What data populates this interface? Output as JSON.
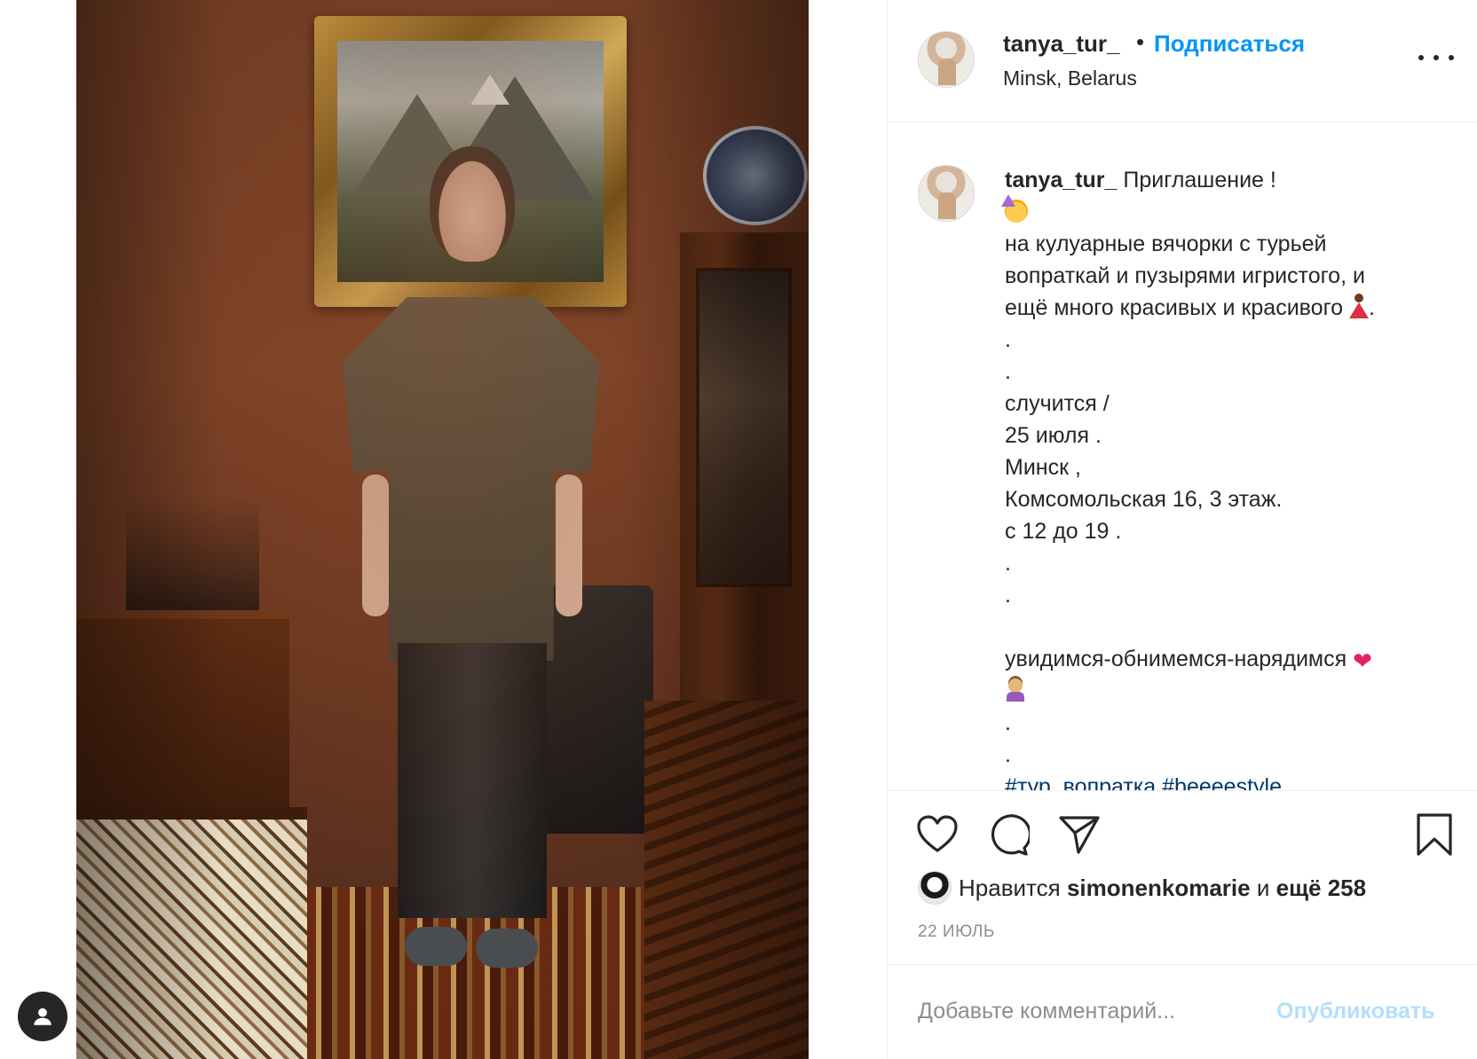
{
  "header": {
    "username": "tanya_tur_",
    "separator": "•",
    "follow_label": "Подписаться",
    "location": "Minsk, Belarus"
  },
  "caption": {
    "username": "tanya_tur_",
    "lines": [
      "Приглашение !",
      "на кулуарные вячорки с турьей",
      "вопраткай и пузырями игристого, и",
      "ещё много красивых и красивого",
      ".",
      ".",
      "случится /",
      "25 июля .",
      "Минск ,",
      "Комсомольская 16, 3 этаж.",
      "с 12 до 19 .",
      ".",
      ".",
      "",
      "увидимся-обнимемся-нарядимся",
      ".",
      "."
    ],
    "hashtags": "#тур_вопратка #beeeestyle"
  },
  "likes": {
    "prefix": "Нравится",
    "user": "simonenkomarie",
    "middle": "и",
    "others": "ещё 258"
  },
  "date": "22 ИЮЛЬ",
  "comment": {
    "placeholder": "Добавьте комментарий...",
    "publish_label": "Опубликовать"
  },
  "colors": {
    "accent": "#0095f6",
    "publish_disabled": "#b2dffc",
    "heart_emoji": "#e0245e",
    "secondary_text": "#8e8e8e"
  },
  "icons": [
    "heart-icon",
    "comment-icon",
    "share-icon",
    "bookmark-icon",
    "more-icon",
    "user-icon"
  ]
}
